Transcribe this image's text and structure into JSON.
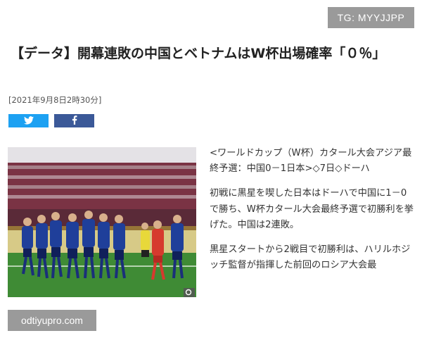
{
  "watermark_top": "TG: MYYJJPP",
  "watermark_bottom": "odtiyupro.com",
  "article": {
    "title": "【データ】開幕連敗の中国とベトナムはW杯出場確率「０％」",
    "date": "[2021年9月8日2時30分]",
    "paragraphs": [
      "<ワールドカップ（W杯）カタール大会アジア最終予選：中国0－1日本>◇7日◇ドーハ",
      "初戦に黒星を喫した日本はドーハで中国に1－0で勝ち、W杯カタール大会最終予選で初勝利を挙げた。中国は2連敗。",
      "黒星スタートから2戦目で初勝利は、ハリルホジッチ監督が指揮した前回のロシア大会最"
    ]
  },
  "share": {
    "twitter_icon": "twitter-bird-icon",
    "facebook_icon": "facebook-f-icon",
    "twitter_color": "#1da1f2",
    "facebook_color": "#3b5998"
  },
  "photo": {
    "subject": "japan-team-celebration",
    "corner_icon": "zoom-icon"
  }
}
